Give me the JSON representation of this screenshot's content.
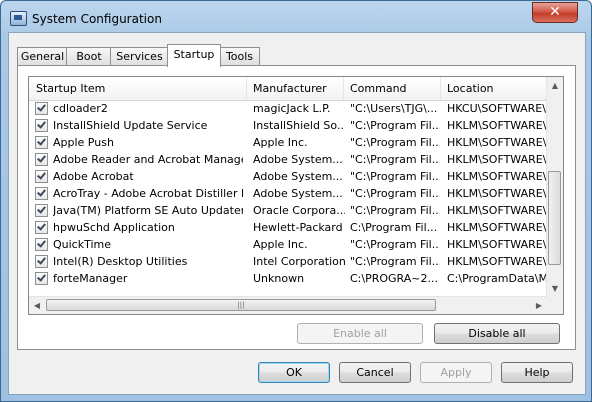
{
  "window": {
    "title": "System Configuration",
    "close_glyph": "✕"
  },
  "tabs": [
    "General",
    "Boot",
    "Services",
    "Startup",
    "Tools"
  ],
  "active_tab": "Startup",
  "table": {
    "columns": [
      "Startup Item",
      "Manufacturer",
      "Command",
      "Location"
    ],
    "rows": [
      {
        "checked": true,
        "item": "cdloader2",
        "manufacturer": "magicJack L.P.",
        "command": "\"C:\\Users\\TJG\\...",
        "location": "HKCU\\SOFTWARE\\"
      },
      {
        "checked": true,
        "item": "InstallShield Update Service",
        "manufacturer": "InstallShield So...",
        "command": "\"C:\\Program Fil...",
        "location": "HKLM\\SOFTWARE\\"
      },
      {
        "checked": true,
        "item": "Apple Push",
        "manufacturer": "Apple Inc.",
        "command": "\"C:\\Program Fil...",
        "location": "HKLM\\SOFTWARE\\"
      },
      {
        "checked": true,
        "item": "Adobe Reader and Acrobat Manager",
        "manufacturer": "Adobe System...",
        "command": "\"C:\\Program Fil...",
        "location": "HKLM\\SOFTWARE\\"
      },
      {
        "checked": true,
        "item": "Adobe Acrobat",
        "manufacturer": "Adobe System...",
        "command": "\"C:\\Program Fil...",
        "location": "HKLM\\SOFTWARE\\"
      },
      {
        "checked": true,
        "item": "AcroTray - Adobe Acrobat Distiller hel...",
        "manufacturer": "Adobe System...",
        "command": "\"C:\\Program Fil...",
        "location": "HKLM\\SOFTWARE\\"
      },
      {
        "checked": true,
        "item": "Java(TM) Platform SE Auto Updater",
        "manufacturer": "Oracle Corpora...",
        "command": "\"C:\\Program Fil...",
        "location": "HKLM\\SOFTWARE\\"
      },
      {
        "checked": true,
        "item": "hpwuSchd Application",
        "manufacturer": "Hewlett-Packard",
        "command": "C:\\Program Fil...",
        "location": "HKLM\\SOFTWARE\\"
      },
      {
        "checked": true,
        "item": "QuickTime",
        "manufacturer": "Apple Inc.",
        "command": "\"C:\\Program Fil...",
        "location": "HKLM\\SOFTWARE\\"
      },
      {
        "checked": true,
        "item": "Intel(R) Desktop Utilities",
        "manufacturer": "Intel Corporation",
        "command": "\"C:\\Program Fil...",
        "location": "HKLM\\SOFTWARE\\"
      },
      {
        "checked": true,
        "item": "forteManager",
        "manufacturer": "Unknown",
        "command": "C:\\PROGRA~2...",
        "location": "C:\\ProgramData\\Mi"
      }
    ]
  },
  "buttons": {
    "enable_all": "Enable all",
    "disable_all": "Disable all",
    "ok": "OK",
    "cancel": "Cancel",
    "apply": "Apply",
    "help": "Help"
  },
  "scroll": {
    "up": "▲",
    "down": "▼",
    "left": "◀",
    "right": "▶",
    "grip": "|||"
  }
}
